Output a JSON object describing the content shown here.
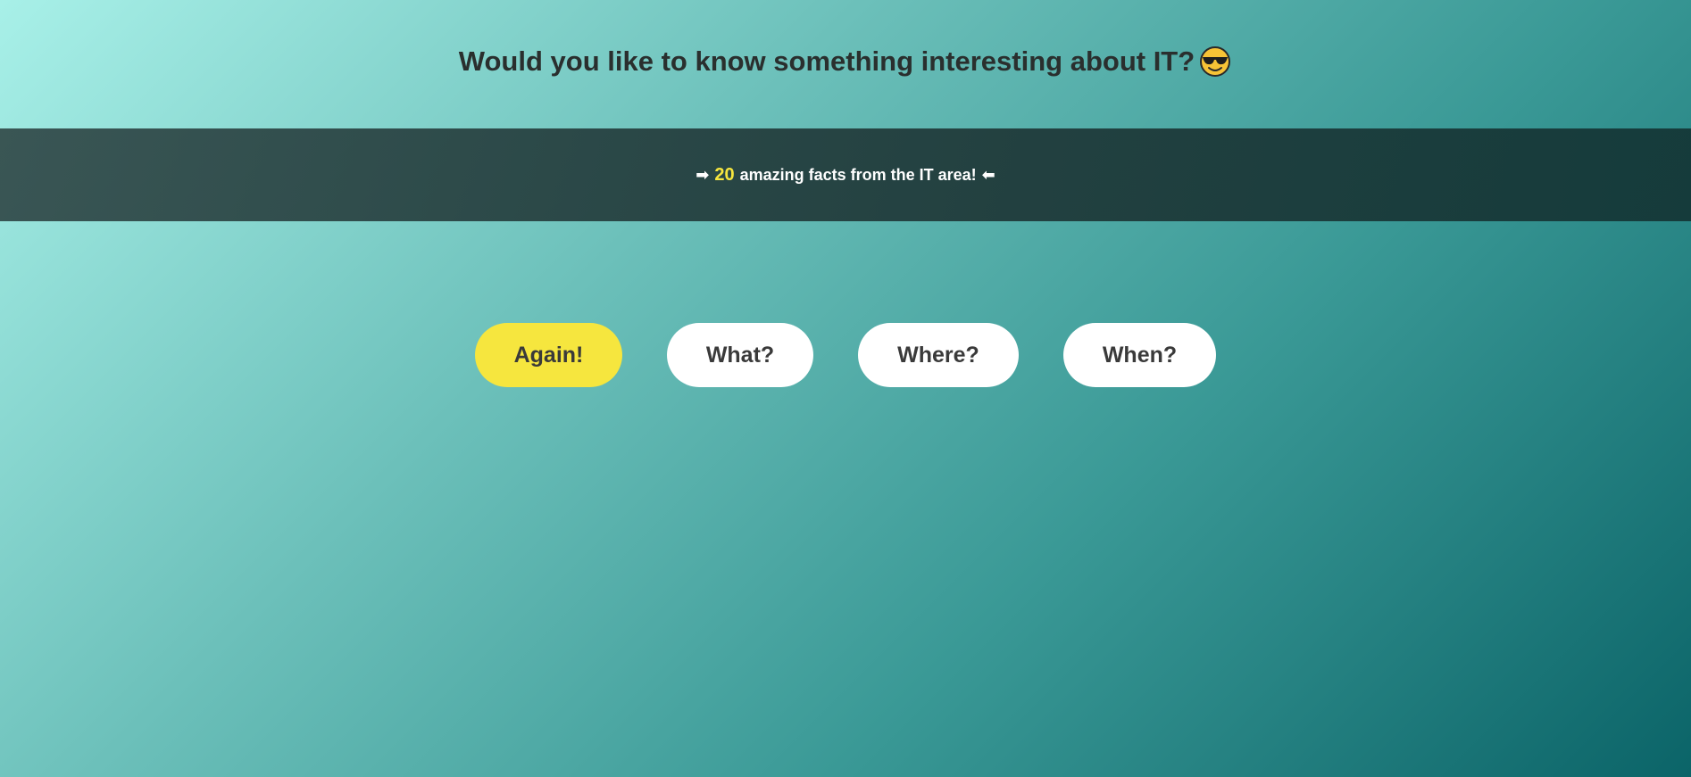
{
  "header": {
    "title": "Would you like to know something interesting about IT?",
    "emoji": "sunglasses-face-icon"
  },
  "banner": {
    "arrow_left": "➡",
    "count": "20",
    "text": "amazing facts from the IT area!",
    "arrow_right": "⬅",
    "count_color": "#f6e63e"
  },
  "buttons": {
    "again": "Again!",
    "what": "What?",
    "where": "Where?",
    "when": "When?"
  },
  "colors": {
    "accent": "#f6e63e",
    "banner_bg": "#223f3f",
    "text_dark": "#2a2f2e"
  }
}
